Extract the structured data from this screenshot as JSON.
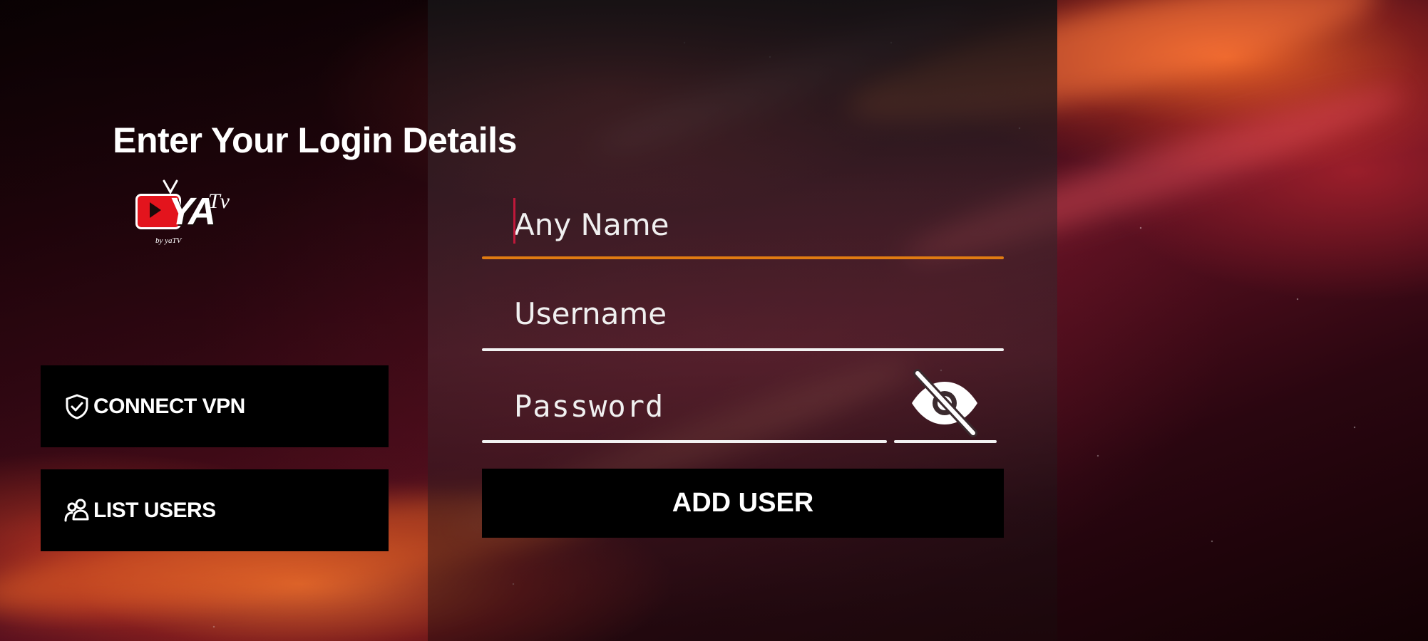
{
  "brand": {
    "logo_text": "YA",
    "logo_suffix": "Tv",
    "logo_tagline": "by yaTV"
  },
  "sidebar": {
    "connect_vpn": {
      "label": "CONNECT VPN",
      "icon": "shield-check-icon"
    },
    "list_users": {
      "label": "LIST USERS",
      "icon": "users-icon"
    }
  },
  "form": {
    "title": "Enter Your Login Details",
    "any_name": {
      "placeholder": "Any Name",
      "value": ""
    },
    "username": {
      "placeholder": "Username",
      "value": ""
    },
    "password": {
      "placeholder": "Password",
      "value": ""
    },
    "toggle_icon": "eye-off-icon",
    "submit_label": "ADD USER"
  },
  "colors": {
    "focus_underline": "#e07b12",
    "underline": "#f2f2f2",
    "button_bg": "#000000",
    "logo_red": "#e3141d",
    "caret": "#c0183a"
  }
}
